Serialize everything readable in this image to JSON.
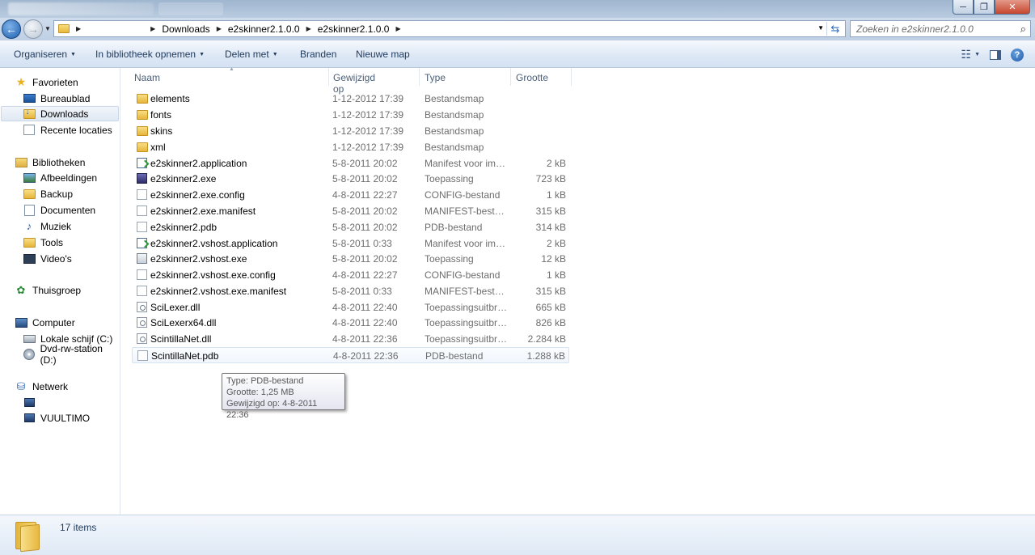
{
  "window": {
    "minimize_glyph": "─",
    "maximize_glyph": "❐",
    "close_glyph": "✕"
  },
  "address": {
    "crumbs": [
      "Downloads",
      "e2skinner2.1.0.0",
      "e2skinner2.1.0.0"
    ],
    "search_placeholder": "Zoeken in e2skinner2.1.0.0"
  },
  "toolbar": {
    "organize": "Organiseren",
    "include_library": "In bibliotheek opnemen",
    "share_with": "Delen met",
    "burn": "Branden",
    "new_folder": "Nieuwe map"
  },
  "nav": {
    "favorites": "Favorieten",
    "desktop": "Bureaublad",
    "downloads": "Downloads",
    "recent": "Recente locaties",
    "libraries": "Bibliotheken",
    "pictures": "Afbeeldingen",
    "backup": "Backup",
    "documents": "Documenten",
    "music": "Muziek",
    "tools": "Tools",
    "videos": "Video's",
    "homegroup": "Thuisgroep",
    "computer": "Computer",
    "local_disk": "Lokale schijf (C:)",
    "dvd": "Dvd-rw-station (D:)",
    "network": "Netwerk",
    "network_pc2": "VUULTIMO"
  },
  "columns": {
    "name": "Naam",
    "modified": "Gewijzigd op",
    "type": "Type",
    "size": "Grootte"
  },
  "files": [
    {
      "name": "elements",
      "date": "1-12-2012 17:39",
      "type": "Bestandsmap",
      "size": "",
      "icon": "folder"
    },
    {
      "name": "fonts",
      "date": "1-12-2012 17:39",
      "type": "Bestandsmap",
      "size": "",
      "icon": "folder"
    },
    {
      "name": "skins",
      "date": "1-12-2012 17:39",
      "type": "Bestandsmap",
      "size": "",
      "icon": "folder"
    },
    {
      "name": "xml",
      "date": "1-12-2012 17:39",
      "type": "Bestandsmap",
      "size": "",
      "icon": "folder"
    },
    {
      "name": "e2skinner2.application",
      "date": "5-8-2011 20:02",
      "type": "Manifest voor imp...",
      "size": "2 kB",
      "icon": "app"
    },
    {
      "name": "e2skinner2.exe",
      "date": "5-8-2011 20:02",
      "type": "Toepassing",
      "size": "723 kB",
      "icon": "exe"
    },
    {
      "name": "e2skinner2.exe.config",
      "date": "4-8-2011 22:27",
      "type": "CONFIG-bestand",
      "size": "1 kB",
      "icon": "doc"
    },
    {
      "name": "e2skinner2.exe.manifest",
      "date": "5-8-2011 20:02",
      "type": "MANIFEST-bestand",
      "size": "315 kB",
      "icon": "doc"
    },
    {
      "name": "e2skinner2.pdb",
      "date": "5-8-2011 20:02",
      "type": "PDB-bestand",
      "size": "314 kB",
      "icon": "doc"
    },
    {
      "name": "e2skinner2.vshost.application",
      "date": "5-8-2011 0:33",
      "type": "Manifest voor imp...",
      "size": "2 kB",
      "icon": "app"
    },
    {
      "name": "e2skinner2.vshost.exe",
      "date": "5-8-2011 20:02",
      "type": "Toepassing",
      "size": "12 kB",
      "icon": "win"
    },
    {
      "name": "e2skinner2.vshost.exe.config",
      "date": "4-8-2011 22:27",
      "type": "CONFIG-bestand",
      "size": "1 kB",
      "icon": "doc"
    },
    {
      "name": "e2skinner2.vshost.exe.manifest",
      "date": "5-8-2011 0:33",
      "type": "MANIFEST-bestand",
      "size": "315 kB",
      "icon": "doc"
    },
    {
      "name": "SciLexer.dll",
      "date": "4-8-2011 22:40",
      "type": "Toepassingsuitbre...",
      "size": "665 kB",
      "icon": "dll"
    },
    {
      "name": "SciLexerx64.dll",
      "date": "4-8-2011 22:40",
      "type": "Toepassingsuitbre...",
      "size": "826 kB",
      "icon": "dll"
    },
    {
      "name": "ScintillaNet.dll",
      "date": "4-8-2011 22:36",
      "type": "Toepassingsuitbre...",
      "size": "2.284 kB",
      "icon": "dll"
    },
    {
      "name": "ScintillaNet.pdb",
      "date": "4-8-2011 22:36",
      "type": "PDB-bestand",
      "size": "1.288 kB",
      "icon": "doc"
    }
  ],
  "tooltip": {
    "line1": "Type: PDB-bestand",
    "line2": "Grootte: 1,25 MB",
    "line3": "Gewijzigd op: 4-8-2011 22:36"
  },
  "status": {
    "count": "17 items"
  }
}
